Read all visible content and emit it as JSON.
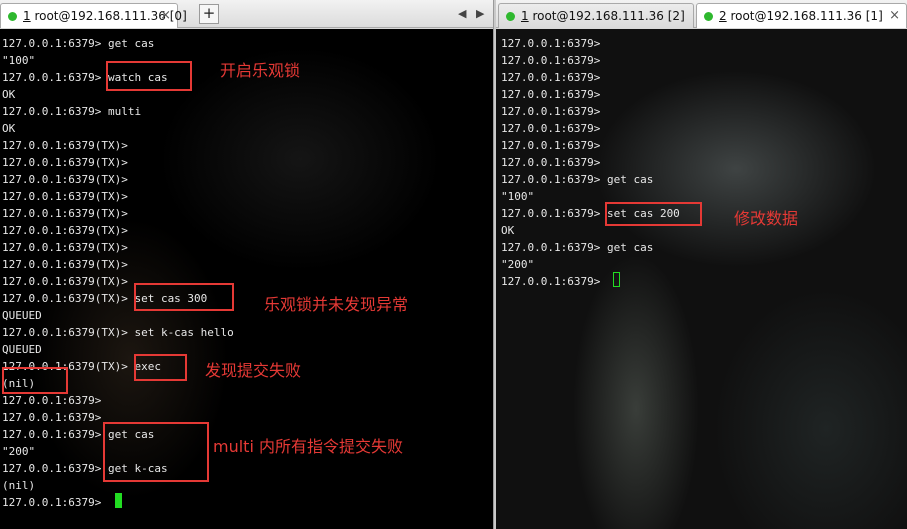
{
  "tabs": {
    "left": {
      "number": "1",
      "title": " root@192.168.111.36 [0]"
    },
    "right": [
      {
        "number": "1",
        "title": " root@192.168.111.36 [2]"
      },
      {
        "number": "2",
        "title": " root@192.168.111.36 [1]"
      }
    ],
    "new_tab_label": "+",
    "close_label": "×",
    "nav_left": "◀",
    "nav_right": "▶"
  },
  "left_terminal": {
    "lines": [
      "127.0.0.1:6379> get cas",
      "\"100\"",
      "127.0.0.1:6379> watch cas",
      "OK",
      "127.0.0.1:6379> multi",
      "OK",
      "127.0.0.1:6379(TX)>",
      "127.0.0.1:6379(TX)>",
      "127.0.0.1:6379(TX)>",
      "127.0.0.1:6379(TX)>",
      "127.0.0.1:6379(TX)>",
      "127.0.0.1:6379(TX)>",
      "127.0.0.1:6379(TX)>",
      "127.0.0.1:6379(TX)>",
      "127.0.0.1:6379(TX)>",
      "127.0.0.1:6379(TX)> set cas 300",
      "QUEUED",
      "127.0.0.1:6379(TX)> set k-cas hello",
      "QUEUED",
      "127.0.0.1:6379(TX)> exec",
      "(nil)",
      "127.0.0.1:6379>",
      "127.0.0.1:6379>",
      "127.0.0.1:6379> get cas",
      "\"200\"",
      "127.0.0.1:6379> get k-cas",
      "(nil)",
      "127.0.0.1:6379> "
    ]
  },
  "right_terminal": {
    "lines": [
      "127.0.0.1:6379>",
      "127.0.0.1:6379>",
      "127.0.0.1:6379>",
      "127.0.0.1:6379>",
      "127.0.0.1:6379>",
      "127.0.0.1:6379>",
      "127.0.0.1:6379>",
      "127.0.0.1:6379>",
      "127.0.0.1:6379> get cas",
      "\"100\"",
      "127.0.0.1:6379> set cas 200",
      "OK",
      "127.0.0.1:6379> get cas",
      "\"200\"",
      "127.0.0.1:6379> "
    ]
  },
  "annotations": {
    "enable_optimistic_lock": "开启乐观锁",
    "lock_not_triggered": "乐观锁并未发现异常",
    "exec_failed": "发现提交失败",
    "multi_all_failed": "multi 内所有指令提交失败",
    "modify_data": "修改数据"
  },
  "colors": {
    "annotation": "#e53935",
    "cursor": "#22dd22",
    "tab_status_dot": "#2eb82e",
    "terminal_text": "#e8e8e8"
  }
}
